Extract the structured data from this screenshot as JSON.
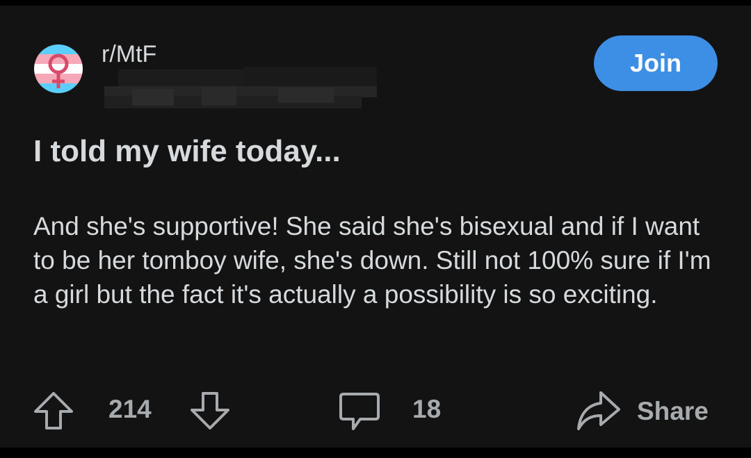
{
  "post": {
    "subreddit": "r/MtF",
    "join_label": "Join",
    "title": "I told my wife today...",
    "body": "And she's supportive! She said she's bisexual and if I want to be her tomboy wife, she's down. Still not 100% sure if I'm a girl but the fact it's actually a possibility is so exciting.",
    "vote_count": "214",
    "comment_count": "18",
    "share_label": "Share"
  },
  "icons": {
    "avatar": "trans-flag-female-symbol-icon",
    "upvote": "arrow-up-icon",
    "downvote": "arrow-down-icon",
    "comments": "speech-bubble-icon",
    "share": "share-arrow-icon"
  },
  "colors": {
    "background": "#131313",
    "text": "#d7dadc",
    "muted": "#a8abad",
    "join_button": "#3d8ee5",
    "flag_blue": "#5bcefa",
    "flag_pink": "#f5a9b8",
    "symbol": "#d94a6a"
  }
}
